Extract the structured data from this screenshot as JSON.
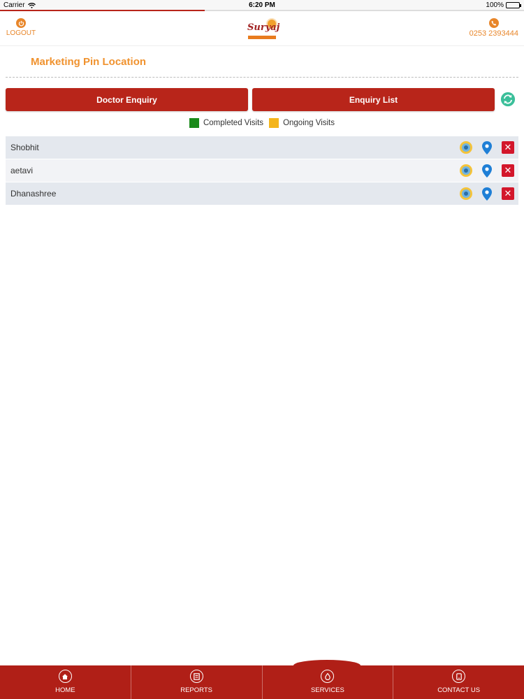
{
  "status_bar": {
    "carrier": "Carrier",
    "time": "6:20 PM",
    "battery": "100%"
  },
  "loading": {
    "progress": 0.39
  },
  "header": {
    "logout_label": "LOGOUT",
    "logo_text": "Suryaj",
    "phone_number": "0253 2393444"
  },
  "page": {
    "title": "Marketing Pin Location"
  },
  "actions": {
    "doctor_enquiry": "Doctor Enquiry",
    "enquiry_list": "Enquiry List"
  },
  "legend": {
    "completed": {
      "label": "Completed Visits",
      "color": "#1a8a1a"
    },
    "ongoing": {
      "label": "Ongoing Visits",
      "color": "#f4b51c"
    }
  },
  "rows": [
    {
      "name": "Shobhit"
    },
    {
      "name": "aetavi"
    },
    {
      "name": "Dhanashree"
    }
  ],
  "nav": [
    {
      "label": "HOME"
    },
    {
      "label": "REPORTS"
    },
    {
      "label": "SERVICES"
    },
    {
      "label": "CONTACT US"
    }
  ],
  "colors": {
    "brand_red": "#b8251a",
    "accent_orange": "#f0922e",
    "refresh_teal": "#3bbf9a",
    "pin_blue": "#1f7fd6",
    "delete_red": "#d3172b"
  },
  "icons": [
    "wifi-icon",
    "battery-icon",
    "power-icon",
    "phone-icon",
    "refresh-icon",
    "visit-status-icon",
    "map-pin-icon",
    "delete-icon",
    "home-icon",
    "reports-icon",
    "services-icon",
    "contact-icon"
  ]
}
